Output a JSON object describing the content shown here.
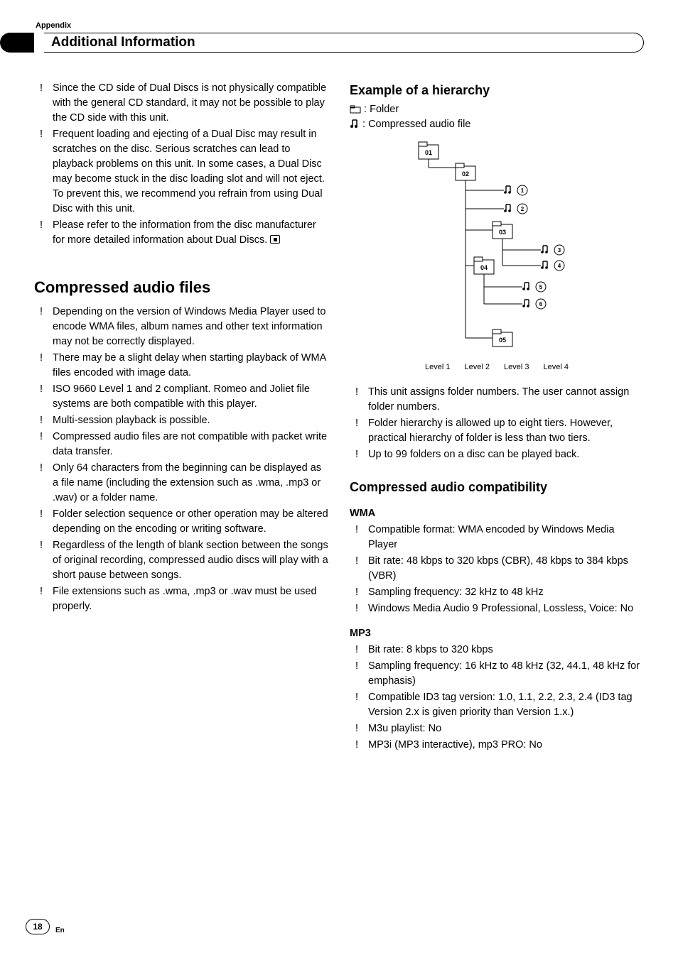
{
  "header": {
    "appendix": "Appendix",
    "title": "Additional Information"
  },
  "left": {
    "intro": [
      "Since the CD side of Dual Discs is not physically compatible with the general CD standard, it may not be possible to play the CD side with this unit.",
      "Frequent loading and ejecting of a Dual Disc may result in scratches on the disc. Serious scratches can lead to playback problems on this unit. In some cases, a Dual Disc may become stuck in the disc loading slot and will not eject. To prevent this, we recommend you refrain from using Dual Disc with this unit.",
      "Please refer to the information from the disc manufacturer for more detailed information about Dual Discs."
    ],
    "h1": "Compressed audio files",
    "items": [
      "Depending on the version of Windows Media Player used to encode WMA files, album names and other text information may not be correctly displayed.",
      "There may be a slight delay when starting playback of WMA files encoded with image data.",
      "ISO 9660 Level 1 and 2 compliant. Romeo and Joliet file systems are both compatible with this player.",
      "Multi-session playback is possible.",
      "Compressed audio files are not compatible with packet write data transfer.",
      "Only 64 characters from the beginning can be displayed as a file name (including the extension such as .wma, .mp3 or .wav) or a folder name.",
      "Folder selection sequence or other operation may be altered depending on the encoding or writing software.",
      "Regardless of the length of blank section between the songs of original recording, compressed audio discs will play with a short pause between songs.",
      "File extensions such as .wma, .mp3 or .wav must be used properly."
    ]
  },
  "right": {
    "h2a": "Example of a hierarchy",
    "folder_label": ": Folder",
    "audio_label": ": Compressed audio file",
    "levels": [
      "Level 1",
      "Level 2",
      "Level 3",
      "Level 4"
    ],
    "hier_items": [
      "This unit assigns folder numbers. The user cannot assign folder numbers.",
      "Folder hierarchy is allowed up to eight tiers. However, practical hierarchy of folder is less than two tiers.",
      "Up to 99 folders on a disc can be played back."
    ],
    "h2b": "Compressed audio compatibility",
    "wma_h": "WMA",
    "wma": [
      "Compatible format: WMA encoded by Windows Media Player",
      "Bit rate: 48 kbps to 320 kbps (CBR), 48 kbps to 384 kbps (VBR)",
      "Sampling frequency: 32 kHz to 48 kHz",
      "Windows Media Audio 9 Professional, Lossless, Voice: No"
    ],
    "mp3_h": "MP3",
    "mp3": [
      "Bit rate: 8 kbps to 320 kbps",
      "Sampling frequency: 16 kHz to 48 kHz (32, 44.1, 48 kHz for emphasis)",
      "Compatible ID3 tag version: 1.0, 1.1, 2.2, 2.3, 2.4 (ID3 tag Version 2.x is given priority than Version 1.x.)",
      "M3u playlist: No",
      "MP3i (MP3 interactive), mp3 PRO: No"
    ]
  },
  "chart_data": {
    "type": "diagram",
    "title": "Example of a hierarchy",
    "nodes": [
      {
        "id": "01",
        "type": "folder",
        "level": 1
      },
      {
        "id": "02",
        "type": "folder",
        "level": 2,
        "parent": "01"
      },
      {
        "id": "1",
        "type": "file",
        "level": 3,
        "parent": "02",
        "circled": 1
      },
      {
        "id": "2",
        "type": "file",
        "level": 3,
        "parent": "02",
        "circled": 2
      },
      {
        "id": "03",
        "type": "folder",
        "level": 3,
        "parent": "02"
      },
      {
        "id": "3",
        "type": "file",
        "level": 4,
        "parent": "03",
        "circled": 3
      },
      {
        "id": "4",
        "type": "file",
        "level": 4,
        "parent": "03",
        "circled": 4
      },
      {
        "id": "04",
        "type": "folder",
        "level": 3,
        "parent": "02"
      },
      {
        "id": "5",
        "type": "file",
        "level": 4,
        "parent": "04",
        "circled": 5
      },
      {
        "id": "6",
        "type": "file",
        "level": 4,
        "parent": "04",
        "circled": 6
      },
      {
        "id": "05",
        "type": "folder",
        "level": 3,
        "parent": "02"
      }
    ],
    "level_labels": [
      "Level 1",
      "Level 2",
      "Level 3",
      "Level 4"
    ]
  },
  "footer": {
    "page": "18",
    "lang": "En"
  }
}
